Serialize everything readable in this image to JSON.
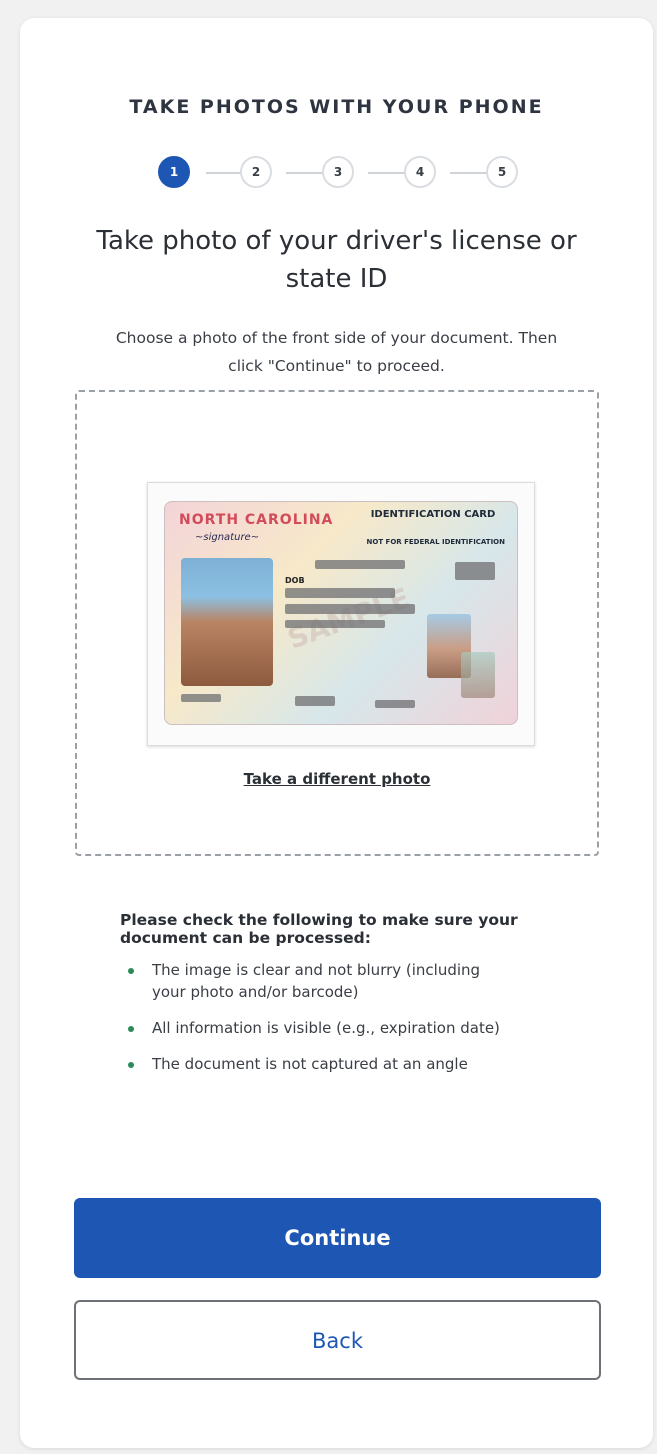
{
  "header": {
    "eyebrow": "TAKE PHOTOS WITH YOUR PHONE"
  },
  "stepper": {
    "steps": [
      "1",
      "2",
      "3",
      "4",
      "5"
    ],
    "current": 1
  },
  "main": {
    "title": "Take photo of your driver's license or state ID",
    "instructions": "Choose a photo of the front side of your document. Then click \"Continue\" to proceed.",
    "retake_link": "Take a different photo"
  },
  "id_preview": {
    "state": "NORTH CAROLINA",
    "heading": "IDENTIFICATION CARD",
    "subheading": "NOT FOR FEDERAL IDENTIFICATION",
    "dob_label": "DOB",
    "watermark": "SAMPLE"
  },
  "checklist": {
    "heading": "Please check the following to make sure your document can be processed:",
    "items": [
      "The image is clear and not blurry (including your photo and/or barcode)",
      "All information is visible (e.g., expiration date)",
      "The document is not captured at an angle"
    ]
  },
  "buttons": {
    "continue_label": "Continue",
    "back_label": "Back"
  },
  "colors": {
    "primary": "#1d56b3",
    "bullet": "#2b8a5a",
    "text": "#2b2f36"
  }
}
